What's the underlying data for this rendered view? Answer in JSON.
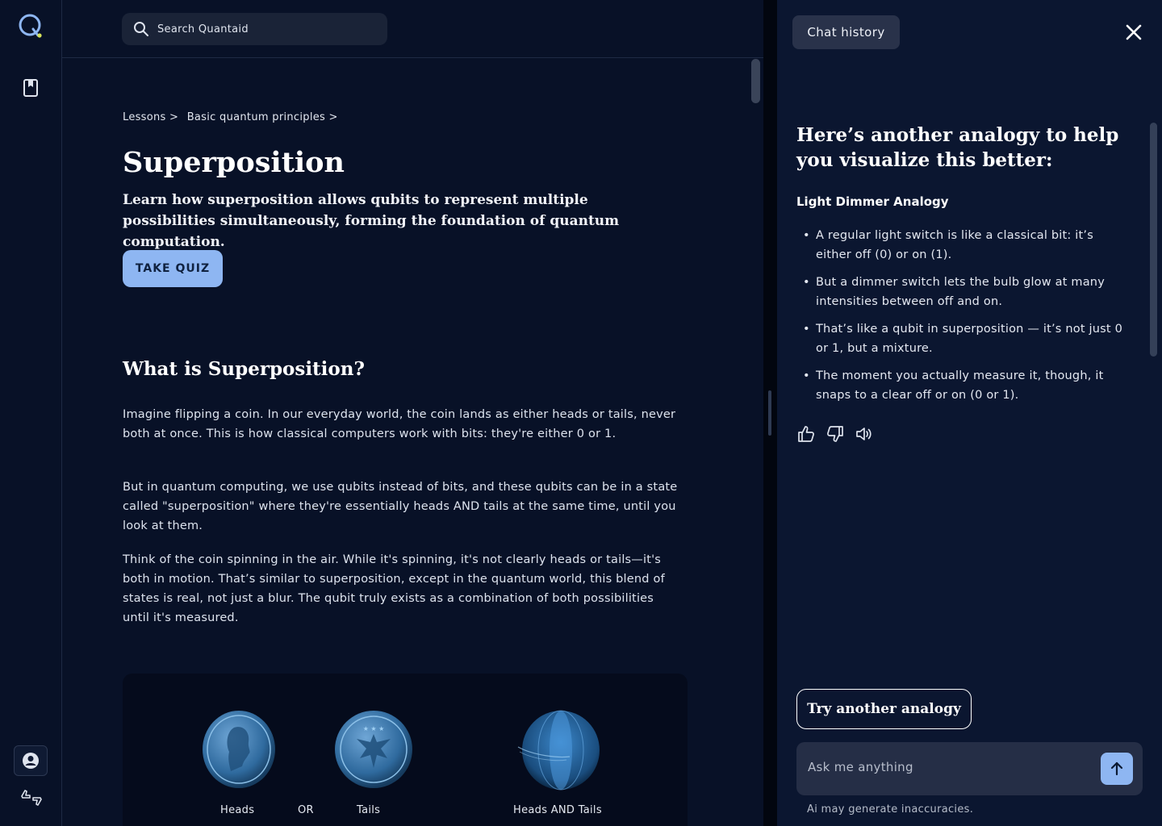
{
  "search": {
    "placeholder": "Search Quantaid"
  },
  "breadcrumb": {
    "items": [
      "Lessons >",
      "Basic quantum principles >"
    ]
  },
  "lesson": {
    "title": "Superposition",
    "lead": "Learn how superposition allows qubits to represent multiple possibilities simultaneously, forming the foundation of quantum computation.",
    "quiz_label": "TAKE QUIZ",
    "section_title": "What is Superposition?",
    "paragraphs": [
      "Imagine flipping a coin. In our everyday world, the coin lands as either heads or tails, never both at once. This is how classical computers work with bits: they're either 0 or 1.",
      "But in quantum computing, we use qubits instead of bits, and these qubits can be in a state called \"superposition\" where they're essentially heads AND tails at the same time, until you look at them.",
      "Think of the coin spinning in the air. While it's spinning, it's not clearly heads or tails—it's both in motion. That’s similar to superposition, except in the quantum world, this blend of states is real, not just a blur. The qubit truly exists as a combination of both possibilities until it's measured."
    ]
  },
  "figure": {
    "labels": {
      "heads": "Heads",
      "or": "OR",
      "tails": "Tails",
      "both": "Heads AND Tails"
    }
  },
  "chat": {
    "history_label": "Chat history",
    "heading": "Here’s another analogy to help you visualize this better:",
    "subheading": "Light Dimmer Analogy",
    "bullets": [
      "A regular light switch is like a classical bit: it’s either off (0) or on (1).",
      "But a dimmer switch lets the bulb glow at many intensities between off and on.",
      "That’s like a qubit in superposition — it’s not just 0 or 1, but a mixture.",
      "The moment you actually measure it, though, it snaps to a clear off or on (0 or 1)."
    ],
    "try_label": "Try another analogy",
    "input_placeholder": "Ask me anything",
    "disclaimer": "Ai may generate inaccuracies."
  },
  "colors": {
    "accent": "#8eb6f2",
    "background": "#081127",
    "panel": "#0b1630",
    "logo_dot": "#d6e25a"
  },
  "icons": [
    "quantaid-logo-icon",
    "book-icon",
    "user-icon",
    "feedback-icon",
    "search-icon",
    "close-icon",
    "thumbs-up-icon",
    "thumbs-down-icon",
    "speaker-icon",
    "arrow-up-icon"
  ]
}
